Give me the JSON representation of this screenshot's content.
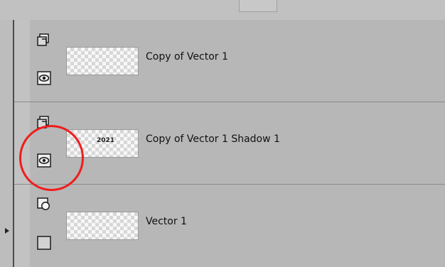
{
  "layers": [
    {
      "label": "Copy of Vector 1",
      "thumbnail_mark": "˚",
      "top_icon": "layer-copy-icon",
      "bottom_icon": "visibility-eye-icon"
    },
    {
      "label": "Copy of Vector 1 Shadow 1",
      "thumbnail_mark": "2021",
      "top_icon": "layer-copy-icon",
      "bottom_icon": "visibility-eye-icon"
    },
    {
      "label": "Vector 1",
      "thumbnail_mark": "˚",
      "top_icon": "vector-shape-icon",
      "bottom_icon": "empty-square-icon"
    }
  ],
  "colors": {
    "panel": "#b7b7b7",
    "strip": "#c2c2c2",
    "ring": "#ef1d1d",
    "text": "#111111"
  }
}
